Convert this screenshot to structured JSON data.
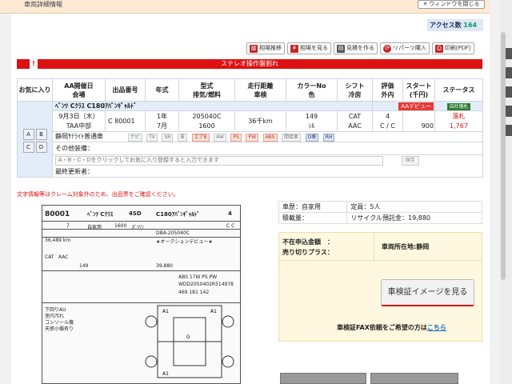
{
  "header": {
    "title": "車両詳細情報",
    "close_label": "ウィンドウを閉じる"
  },
  "access": {
    "label": "アクセス数",
    "count": "164"
  },
  "toolbar": [
    {
      "label": "相場推移",
      "icon": "chart-icon"
    },
    {
      "label": "相場を見る",
      "icon": "yen-icon"
    },
    {
      "label": "見積を作る",
      "icon": "calc-icon"
    },
    {
      "label": "リパーツ購入",
      "icon": "parts-icon"
    },
    {
      "label": "印刷(PDF)",
      "icon": "printer-icon"
    }
  ],
  "alert": {
    "mark": "!",
    "text": "ステレオ操作盤割れ"
  },
  "table": {
    "headers": {
      "fav": "お気に入り",
      "date": [
        "AA開催日",
        "会場"
      ],
      "lot": "出品番号",
      "year": "年式",
      "model": [
        "型式",
        "排気/燃料"
      ],
      "mileage": [
        "走行距離",
        "車検"
      ],
      "color": [
        "カラーNo",
        "色"
      ],
      "shift": [
        "シフト",
        "冷房"
      ],
      "grade": [
        "評価",
        "外内"
      ],
      "start": [
        "スタート",
        "(千円)"
      ],
      "status": "ステータス"
    },
    "car_name": "ﾍﾞﾝﾂ Cｸﾗｽ C180ｱﾊﾞﾝｷﾞｬﾙﾄﾞ",
    "aa_badge": "AAデビュー",
    "status_badge": "自社落札",
    "date": "9月3日（木）",
    "venue": "TAA中部",
    "lot": "C 80001",
    "year_a": "1年",
    "year_b": "7月",
    "model": "205040C",
    "displacement": "1600",
    "mileage": "36千km",
    "color_no": "149",
    "color": "ｼﾙ",
    "shift": "CAT",
    "ac": "AAC",
    "grade": "4",
    "grade_ext_int": "C / C",
    "start_price": "900",
    "status": "落札",
    "sold_price": "1,767",
    "region": "静岡ｻﾃﾗｲﾄ普通車",
    "options": [
      {
        "label": "ナビ",
        "on": false
      },
      {
        "label": "TV",
        "on": false
      },
      {
        "label": "SR",
        "on": false
      },
      {
        "label": "革",
        "on": false
      },
      {
        "label": "エアB",
        "on": true
      },
      {
        "label": "AW",
        "on": false
      },
      {
        "label": "PS",
        "on": true
      },
      {
        "label": "PW",
        "on": true
      },
      {
        "label": "ABS",
        "on": true
      },
      {
        "label": "間接車",
        "on": false
      },
      {
        "label": "D車",
        "on": false,
        "d": true
      },
      {
        "label": "RH",
        "on": false,
        "d": true
      }
    ],
    "other_equipment": "その他装備：",
    "memo_placeholder": "A・B・C・Dをクリックしてお気に入り登録すると入力できます",
    "save_label": "保存",
    "last_updater": "最終更新者：",
    "fav_buttons": [
      "A",
      "B",
      "C",
      "D"
    ]
  },
  "notice": "文字情報等はクレーム対象外のため、出品票をご確認ください。",
  "sheet": {
    "lot": "80001",
    "name": "ﾍﾞﾝﾂ Cｸﾗｽ",
    "body": "4SD",
    "grade_name": "C180ｱﾊﾞﾝｷﾞｬﾙﾄﾞ",
    "score": "4",
    "year_short": "7",
    "reg": "自家用",
    "cc": "1600",
    "fuel": "ｶﾞｿﾘﾝ",
    "model_code": "DBA-205040C",
    "ext_int": "C C",
    "mileage": "36,489 km",
    "shift": "CAT",
    "ac": "AAC",
    "color_no": "149",
    "price": "39,880",
    "options": "ABS 17W PS PW",
    "vin": "WDD2050402R514978",
    "size": "469  181  142",
    "notes": [
      "下回りAU",
      "室内汚れ",
      "コンソール傷",
      "天張小傷有り"
    ],
    "memo": "★オークションデビュー★"
  },
  "info": {
    "car_history_label": "車歴：自家用",
    "capacity_label": "定員：",
    "capacity": "5人",
    "load_label": "積載量：",
    "recycle_label": "リサイクル預託金：",
    "recycle": "19,880"
  },
  "panel": {
    "fudo_label": "不在申込金額　：",
    "uri_label": "売り切りプラス：",
    "location_label": "車両所在地:静岡",
    "shaken_button": "車検証イメージを見る",
    "fax_text": "車検証FAX依頼をご希望の方は",
    "fax_link": "こちら"
  },
  "colors": {
    "accent_red": "#dd1111",
    "header_bg": "#fde9d4",
    "name_row": "#e3ecf9",
    "panel_bg": "#fdf8df"
  }
}
